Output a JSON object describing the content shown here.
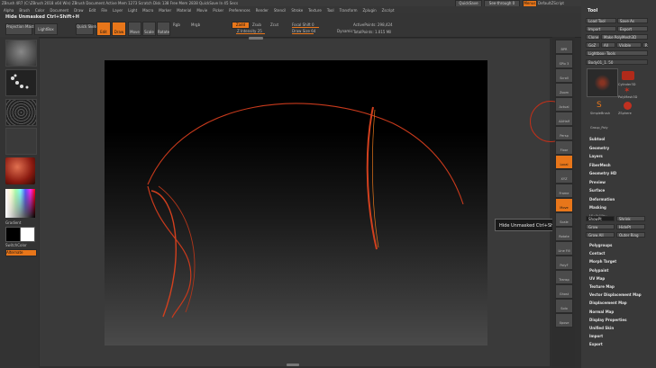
{
  "titlebar": {
    "text": "ZBrush 4R7 (C:\\ZBrush 2018 x64 Win)  ZBrush Document  Active Mem 1273  Scratch Disk 138  Free Mem 2838  QuickSave In 45 Secs",
    "quicksave": "QuickSave",
    "seethrough": "See-through 0",
    "menus": "Menus",
    "defaultscript": "DefaultZScript"
  },
  "menubar": [
    "Alpha",
    "Brush",
    "Color",
    "Document",
    "Draw",
    "Edit",
    "File",
    "Layer",
    "Light",
    "Macro",
    "Marker",
    "Material",
    "Movie",
    "Picker",
    "Preferences",
    "Render",
    "Stencil",
    "Stroke",
    "Texture",
    "Tool",
    "Transform",
    "Zplugin",
    "Zscript"
  ],
  "shelf": {
    "hint": "Hide Unmasked  Ctrl+Shift+H",
    "projection_master": "Projection Master",
    "lightbox": "LightBox",
    "quick_sketch": "Quick Sketch",
    "edit": "Edit",
    "draw": "Draw",
    "move": "Move",
    "scale": "Scale",
    "rotate": "Rotate",
    "rgb": "Rgb",
    "mrgb": "Mrgb",
    "zadd": "Zadd",
    "zsub": "Zsub",
    "zcut": "Zcut",
    "z_intensity": "Z Intensity 25",
    "focal_shift": "Focal Shift 0",
    "draw_size": "Draw Size 64",
    "dynamic": "Dynamic",
    "active_points": "ActivePoints: 298,424",
    "total_points": "TotalPoints: 1.015 Mil"
  },
  "left_tray": {
    "gradient": "Gradient",
    "switch_color": "SwitchColor",
    "alternate": "Alternate"
  },
  "tooltip": "Hide Unmasked  Ctrl+Shift+H",
  "tool_panel": {
    "title": "Tool",
    "load_tool": "Load Tool",
    "save_as": "Save As",
    "import": "Import",
    "export": "Export",
    "clone": "Clone",
    "make_polymesh": "Make PolyMesh3D",
    "goz": "GoZ",
    "all": "All",
    "visible": "Visible",
    "r": "R",
    "lightbox_tools": "Lightbox› Tools",
    "current_tool": "Body01_1. 50",
    "tools": [
      "Cylinder3D",
      "PolyMesh3D",
      "SimpleBrush",
      "ZSphere",
      "Group_Poly"
    ],
    "sections": [
      "Subtool",
      "Geometry",
      "Layers",
      "FiberMesh",
      "Geometry HD",
      "Preview",
      "Surface",
      "Deformation",
      "Masking",
      "Visibility"
    ],
    "visibility_buttons": [
      "ShowPt",
      "Grow",
      "Grow All",
      "Shrink",
      "Outer Ring",
      "HidePt"
    ],
    "sections2": [
      "Polygroups",
      "Contact",
      "Morph Target",
      "Polypaint",
      "UV Map",
      "Texture Map",
      "Vector Displacement Map",
      "Displacement Map",
      "Normal Map",
      "Display Properties",
      "Unified Skin",
      "Import",
      "Export"
    ]
  },
  "right_shelf": [
    "BPR",
    "SPix 3",
    "Scroll",
    "Zoom",
    "Actual",
    "AAHalf",
    "Persp",
    "Floor",
    "Local",
    "XYZ",
    "Frame",
    "Move",
    "Scale",
    "Rotate",
    "Line Fill",
    "PolyF",
    "Transp",
    "Ghost",
    "Solo",
    "Xpose"
  ],
  "colors": {
    "accent": "#e8761a",
    "curve": "#d2401e",
    "bg": "#2f2f2f"
  }
}
